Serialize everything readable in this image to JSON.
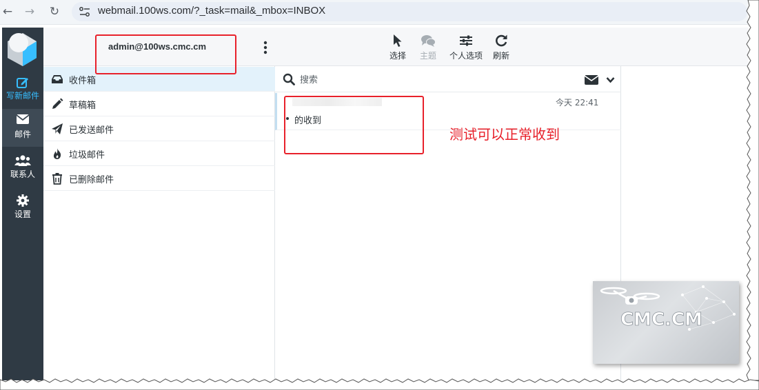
{
  "browser": {
    "url": "webmail.100ws.com/?_task=mail&_mbox=INBOX"
  },
  "sidebar": {
    "items": [
      {
        "label": "写新邮件",
        "icon": "compose-icon"
      },
      {
        "label": "邮件",
        "icon": "envelope-icon"
      },
      {
        "label": "联系人",
        "icon": "users-icon"
      },
      {
        "label": "设置",
        "icon": "gear-icon"
      }
    ]
  },
  "folderpane": {
    "account": "admin@100ws.cmc.cm",
    "folders": [
      {
        "label": "收件箱",
        "icon": "inbox-icon"
      },
      {
        "label": "草稿箱",
        "icon": "pencil-icon"
      },
      {
        "label": "已发送邮件",
        "icon": "paper-plane-icon"
      },
      {
        "label": "垃圾邮件",
        "icon": "fire-icon"
      },
      {
        "label": "已删除邮件",
        "icon": "trash-icon"
      }
    ]
  },
  "toolbar": {
    "buttons": [
      {
        "label": "选择",
        "icon": "pointer-icon",
        "enabled": true
      },
      {
        "label": "主题",
        "icon": "comments-icon",
        "enabled": false
      },
      {
        "label": "个人选项",
        "icon": "sliders-icon",
        "enabled": true
      },
      {
        "label": "刷新",
        "icon": "refresh-icon",
        "enabled": true
      }
    ]
  },
  "search": {
    "placeholder": "搜索"
  },
  "messages": [
    {
      "date": "今天 22:41",
      "subject": "的收到"
    }
  ],
  "annotation": {
    "text": "测试可以正常收到",
    "color": "#e8202a"
  },
  "watermark": {
    "text": "CMC.CM"
  },
  "colors": {
    "sidebar_bg": "#2f3a44",
    "accent": "#37beff",
    "active_folder_bg": "#e3f2fb"
  }
}
